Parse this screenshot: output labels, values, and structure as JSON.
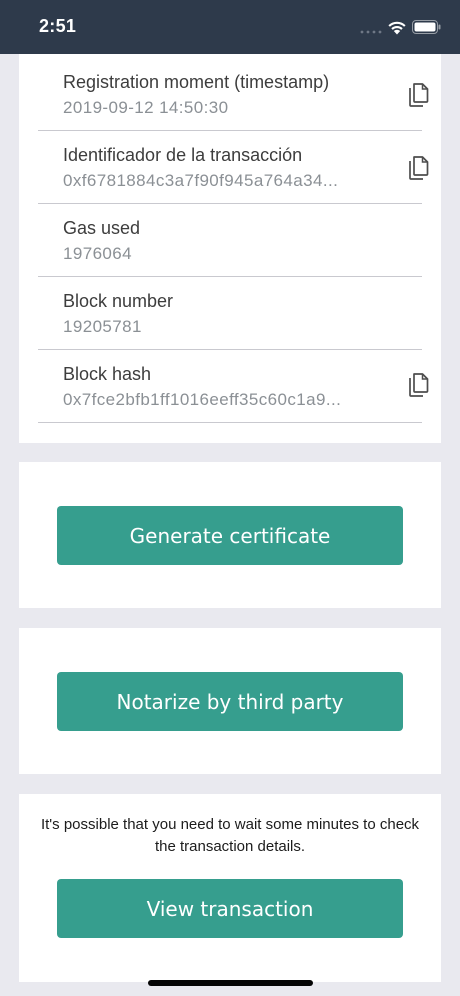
{
  "status_bar": {
    "time": "2:51",
    "signal_icon": "cellular-signal-icon",
    "wifi_icon": "wifi-icon",
    "battery_icon": "battery-icon"
  },
  "details": {
    "rows": [
      {
        "label": "Registration moment (timestamp)",
        "value": "2019-09-12 14:50:30",
        "copy_icon": "copy-icon"
      },
      {
        "label": "Identificador de la transacción",
        "value": "0xf6781884c3a7f90f945a764a34...",
        "copy_icon": "copy-icon"
      },
      {
        "label": "Gas used",
        "value": "1976064"
      },
      {
        "label": "Block number",
        "value": "19205781"
      },
      {
        "label": "Block hash",
        "value": "0x7fce2bfb1ff1016eeff35c60c1a9...",
        "copy_icon": "copy-icon"
      }
    ]
  },
  "actions": {
    "generate_certificate": "Generate certificate",
    "notarize": "Notarize by third party",
    "notice": "It's possible that you need to wait some minutes to check the transaction details.",
    "view_transaction": "View transaction"
  },
  "colors": {
    "status_bar": "#2e3a4b",
    "background": "#e9e9ef",
    "button": "#369e8e",
    "label_text": "#3d3d3d",
    "value_text": "#8b9095"
  }
}
